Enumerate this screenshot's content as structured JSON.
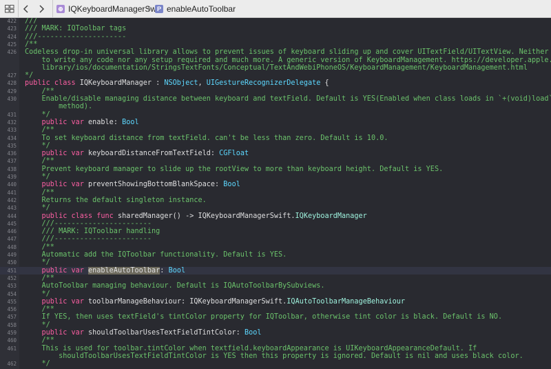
{
  "toolbar": {
    "breadcrumbs": [
      {
        "label": "IQKeyboardManagerSwift",
        "icon": "framework-icon"
      },
      {
        "label": "enableAutoToolbar",
        "icon": "property-icon"
      }
    ]
  },
  "colors": {
    "background": "#292a30",
    "comment": "#6bc26b",
    "keyword": "#fc5fa3",
    "type": "#5dd8ff",
    "project_type": "#9ef1dd",
    "plain": "#dfdfe0",
    "line_number": "#84858c"
  },
  "editor": {
    "lines": [
      {
        "n": "422",
        "y": 0,
        "segs": [
          {
            "t": "///",
            "c": "comment"
          }
        ]
      },
      {
        "n": "423",
        "y": 1,
        "segs": [
          {
            "t": "/// MARK: IQToolbar tags",
            "c": "comment"
          }
        ]
      },
      {
        "n": "424",
        "y": 2,
        "segs": [
          {
            "t": "///---------------------",
            "c": "comment"
          }
        ]
      },
      {
        "n": "425",
        "y": 3,
        "segs": [
          {
            "t": "/**",
            "c": "comment"
          }
        ]
      },
      {
        "n": "426",
        "y": 4,
        "segs": [
          {
            "t": "Codeless drop-in universal library allows to prevent issues of keyboard sliding up and cover UITextField/UITextView. Neither need",
            "c": "comment"
          }
        ]
      },
      {
        "n": "",
        "y": 5,
        "segs": [
          {
            "t": "    to write any code nor any setup required and much more. A generic version of KeyboardManagement. https://developer.apple.com/",
            "c": "comment"
          }
        ]
      },
      {
        "n": "",
        "y": 6,
        "segs": [
          {
            "t": "    library/ios/documentation/StringsTextFonts/Conceptual/TextAndWebiPhoneOS/KeyboardManagement/KeyboardManagement.html",
            "c": "comment"
          }
        ]
      },
      {
        "n": "427",
        "y": 7,
        "segs": [
          {
            "t": "*/",
            "c": "comment"
          }
        ]
      },
      {
        "n": "428",
        "y": 8,
        "segs": [
          {
            "t": "public class ",
            "c": "keyword"
          },
          {
            "t": "IQKeyboardManager : ",
            "c": "plain"
          },
          {
            "t": "NSObject",
            "c": "type"
          },
          {
            "t": ", ",
            "c": "plain"
          },
          {
            "t": "UIGestureRecognizerDelegate",
            "c": "type"
          },
          {
            "t": " {",
            "c": "plain"
          }
        ]
      },
      {
        "n": "429",
        "y": 9,
        "segs": [
          {
            "t": "    /**",
            "c": "comment"
          }
        ]
      },
      {
        "n": "430",
        "y": 10,
        "segs": [
          {
            "t": "    Enable/disable managing distance between keyboard and textField. Default is YES(Enabled when class loads in `+(void)load`",
            "c": "comment"
          }
        ]
      },
      {
        "n": "",
        "y": 11,
        "segs": [
          {
            "t": "        method).",
            "c": "comment"
          }
        ]
      },
      {
        "n": "431",
        "y": 12,
        "segs": [
          {
            "t": "    */",
            "c": "comment"
          }
        ]
      },
      {
        "n": "432",
        "y": 13,
        "segs": [
          {
            "t": "    public var ",
            "c": "keyword"
          },
          {
            "t": "enable: ",
            "c": "plain"
          },
          {
            "t": "Bool",
            "c": "type"
          }
        ]
      },
      {
        "n": "433",
        "y": 14,
        "segs": [
          {
            "t": "    /**",
            "c": "comment"
          }
        ]
      },
      {
        "n": "434",
        "y": 15,
        "segs": [
          {
            "t": "    To set keyboard distance from textField. can't be less than zero. Default is 10.0.",
            "c": "comment"
          }
        ]
      },
      {
        "n": "435",
        "y": 16,
        "segs": [
          {
            "t": "    */",
            "c": "comment"
          }
        ]
      },
      {
        "n": "436",
        "y": 17,
        "segs": [
          {
            "t": "    public var ",
            "c": "keyword"
          },
          {
            "t": "keyboardDistanceFromTextField: ",
            "c": "plain"
          },
          {
            "t": "CGFloat",
            "c": "type"
          }
        ]
      },
      {
        "n": "437",
        "y": 18,
        "segs": [
          {
            "t": "    /**",
            "c": "comment"
          }
        ]
      },
      {
        "n": "438",
        "y": 19,
        "segs": [
          {
            "t": "    Prevent keyboard manager to slide up the rootView to more than keyboard height. Default is YES.",
            "c": "comment"
          }
        ]
      },
      {
        "n": "439",
        "y": 20,
        "segs": [
          {
            "t": "    */",
            "c": "comment"
          }
        ]
      },
      {
        "n": "440",
        "y": 21,
        "segs": [
          {
            "t": "    public var ",
            "c": "keyword"
          },
          {
            "t": "preventShowingBottomBlankSpace: ",
            "c": "plain"
          },
          {
            "t": "Bool",
            "c": "type"
          }
        ]
      },
      {
        "n": "441",
        "y": 22,
        "segs": [
          {
            "t": "    /**",
            "c": "comment"
          }
        ]
      },
      {
        "n": "442",
        "y": 23,
        "segs": [
          {
            "t": "    Returns the default singleton instance.",
            "c": "comment"
          }
        ]
      },
      {
        "n": "443",
        "y": 24,
        "segs": [
          {
            "t": "    */",
            "c": "comment"
          }
        ]
      },
      {
        "n": "444",
        "y": 25,
        "segs": [
          {
            "t": "    public class func ",
            "c": "keyword"
          },
          {
            "t": "sharedManager() -> IQKeyboardManagerSwift.",
            "c": "plain"
          },
          {
            "t": "IQKeyboardManager",
            "c": "project_type"
          }
        ]
      },
      {
        "n": "445",
        "y": 26,
        "segs": [
          {
            "t": "    ///-----------------------",
            "c": "comment"
          }
        ]
      },
      {
        "n": "446",
        "y": 27,
        "segs": [
          {
            "t": "    /// MARK: IQToolbar handling",
            "c": "comment"
          }
        ]
      },
      {
        "n": "447",
        "y": 28,
        "segs": [
          {
            "t": "    ///-----------------------",
            "c": "comment"
          }
        ]
      },
      {
        "n": "448",
        "y": 29,
        "segs": [
          {
            "t": "    /**",
            "c": "comment"
          }
        ]
      },
      {
        "n": "449",
        "y": 30,
        "segs": [
          {
            "t": "    Automatic add the IQToolbar functionality. Default is YES.",
            "c": "comment"
          }
        ]
      },
      {
        "n": "450",
        "y": 31,
        "segs": [
          {
            "t": "    */",
            "c": "comment"
          }
        ]
      },
      {
        "n": "451",
        "y": 32,
        "cur": true,
        "segs": [
          {
            "t": "    public var ",
            "c": "keyword"
          },
          {
            "t": "enableAutoToolbar",
            "c": "plain",
            "hl": true
          },
          {
            "t": ": ",
            "c": "plain"
          },
          {
            "t": "Bool",
            "c": "type"
          }
        ]
      },
      {
        "n": "452",
        "y": 33,
        "segs": [
          {
            "t": "    /**",
            "c": "comment"
          }
        ]
      },
      {
        "n": "453",
        "y": 34,
        "segs": [
          {
            "t": "    AutoToolbar managing behaviour. Default is IQAutoToolbarBySubviews.",
            "c": "comment"
          }
        ]
      },
      {
        "n": "454",
        "y": 35,
        "segs": [
          {
            "t": "    */",
            "c": "comment"
          }
        ]
      },
      {
        "n": "455",
        "y": 36,
        "segs": [
          {
            "t": "    public var ",
            "c": "keyword"
          },
          {
            "t": "toolbarManageBehaviour: IQKeyboardManagerSwift.",
            "c": "plain"
          },
          {
            "t": "IQAutoToolbarManageBehaviour",
            "c": "project_type"
          }
        ]
      },
      {
        "n": "456",
        "y": 37,
        "segs": [
          {
            "t": "    /**",
            "c": "comment"
          }
        ]
      },
      {
        "n": "457",
        "y": 38,
        "segs": [
          {
            "t": "    If YES, then uses textField's tintColor property for IQToolbar, otherwise tint color is black. Default is NO.",
            "c": "comment"
          }
        ]
      },
      {
        "n": "458",
        "y": 39,
        "segs": [
          {
            "t": "    */",
            "c": "comment"
          }
        ]
      },
      {
        "n": "459",
        "y": 40,
        "segs": [
          {
            "t": "    public var ",
            "c": "keyword"
          },
          {
            "t": "shouldToolbarUsesTextFieldTintColor: ",
            "c": "plain"
          },
          {
            "t": "Bool",
            "c": "type"
          }
        ]
      },
      {
        "n": "460",
        "y": 41,
        "segs": [
          {
            "t": "    /**",
            "c": "comment"
          }
        ]
      },
      {
        "n": "461",
        "y": 42,
        "segs": [
          {
            "t": "    This is used for toolbar.tintColor when textfield.keyboardAppearance is UIKeyboardAppearanceDefault. If",
            "c": "comment"
          }
        ]
      },
      {
        "n": "",
        "y": 43,
        "segs": [
          {
            "t": "        shouldToolbarUsesTextFieldTintColor is YES then this property is ignored. Default is nil and uses black color.",
            "c": "comment"
          }
        ]
      },
      {
        "n": "462",
        "y": 44,
        "segs": [
          {
            "t": "    */",
            "c": "comment"
          }
        ]
      }
    ]
  }
}
